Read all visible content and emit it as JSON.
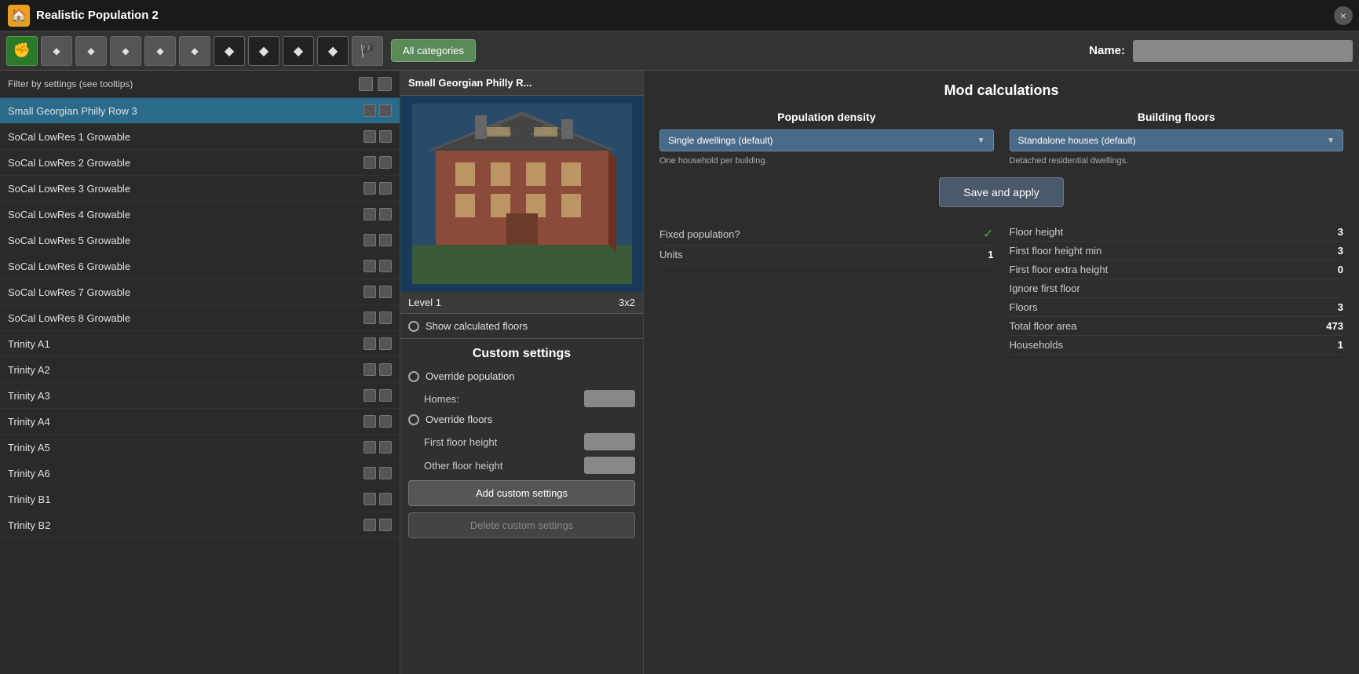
{
  "titleBar": {
    "title": "Realistic Population 2",
    "closeBtn": "×"
  },
  "toolbar": {
    "buttons": [
      {
        "id": "btn1",
        "icon": "✊",
        "active": true
      },
      {
        "id": "btn2",
        "icon": "◆",
        "active": false
      },
      {
        "id": "btn3",
        "icon": "◆",
        "active": false
      },
      {
        "id": "btn4",
        "icon": "◆",
        "active": false
      },
      {
        "id": "btn5",
        "icon": "◆",
        "active": false
      },
      {
        "id": "btn6",
        "icon": "◆",
        "active": false
      },
      {
        "id": "btn7",
        "icon": "◆",
        "active": false
      },
      {
        "id": "btn8",
        "icon": "◆",
        "active": false
      },
      {
        "id": "btn9",
        "icon": "◆",
        "active": false
      },
      {
        "id": "btn10",
        "icon": "◆",
        "active": false
      },
      {
        "id": "btn11",
        "icon": "🏴",
        "active": false
      }
    ],
    "categoriesLabel": "All categories",
    "nameLabel": "Name:",
    "namePlaceholder": ""
  },
  "leftPanel": {
    "filterLabel": "Filter by settings (see tooltips)",
    "items": [
      {
        "name": "Small Georgian Philly Row 3",
        "selected": true
      },
      {
        "name": "SoCal LowRes 1 Growable",
        "selected": false
      },
      {
        "name": "SoCal LowRes 2 Growable",
        "selected": false
      },
      {
        "name": "SoCal LowRes 3 Growable",
        "selected": false
      },
      {
        "name": "SoCal LowRes 4 Growable",
        "selected": false
      },
      {
        "name": "SoCal LowRes 5 Growable",
        "selected": false
      },
      {
        "name": "SoCal LowRes 6 Growable",
        "selected": false
      },
      {
        "name": "SoCal LowRes 7 Growable",
        "selected": false
      },
      {
        "name": "SoCal LowRes 8 Growable",
        "selected": false
      },
      {
        "name": "Trinity A1",
        "selected": false
      },
      {
        "name": "Trinity A2",
        "selected": false
      },
      {
        "name": "Trinity A3",
        "selected": false
      },
      {
        "name": "Trinity A4",
        "selected": false
      },
      {
        "name": "Trinity A5",
        "selected": false
      },
      {
        "name": "Trinity A6",
        "selected": false
      },
      {
        "name": "Trinity B1",
        "selected": false
      },
      {
        "name": "Trinity B2",
        "selected": false
      }
    ]
  },
  "centerPanel": {
    "buildingTitle": "Small Georgian Philly R...",
    "levelLabel": "Level 1",
    "sizeLabel": "3x2",
    "showCalculatedFloors": "Show calculated floors",
    "customSettings": {
      "title": "Custom settings",
      "overridePopulation": "Override population",
      "homesLabel": "Homes:",
      "overrideFloors": "Override floors",
      "firstFloorHeightLabel": "First floor height",
      "otherFloorHeightLabel": "Other floor height",
      "addBtnLabel": "Add custom settings",
      "deleteBtnLabel": "Delete custom settings"
    }
  },
  "rightPanel": {
    "title": "Mod calculations",
    "populationDensity": {
      "title": "Population density",
      "dropdownValue": "Single dwellings (default)",
      "description": "One household per building."
    },
    "buildingFloors": {
      "title": "Building floors",
      "dropdownValue": "Standalone houses (default)",
      "description": "Detached residential dwellings."
    },
    "saveApplyLabel": "Save and apply",
    "stats": {
      "leftColumn": [
        {
          "label": "Fixed population?",
          "value": "✓",
          "isCheck": true
        },
        {
          "label": "Units",
          "value": "1"
        }
      ],
      "rightColumn": [
        {
          "label": "Floor height",
          "value": "3"
        },
        {
          "label": "First floor height min",
          "value": "3"
        },
        {
          "label": "First floor extra height",
          "value": "0"
        },
        {
          "label": "Ignore first floor",
          "value": ""
        },
        {
          "label": "Floors",
          "value": "3"
        },
        {
          "label": "Total floor area",
          "value": "473"
        },
        {
          "label": "Households",
          "value": "1"
        }
      ]
    }
  }
}
